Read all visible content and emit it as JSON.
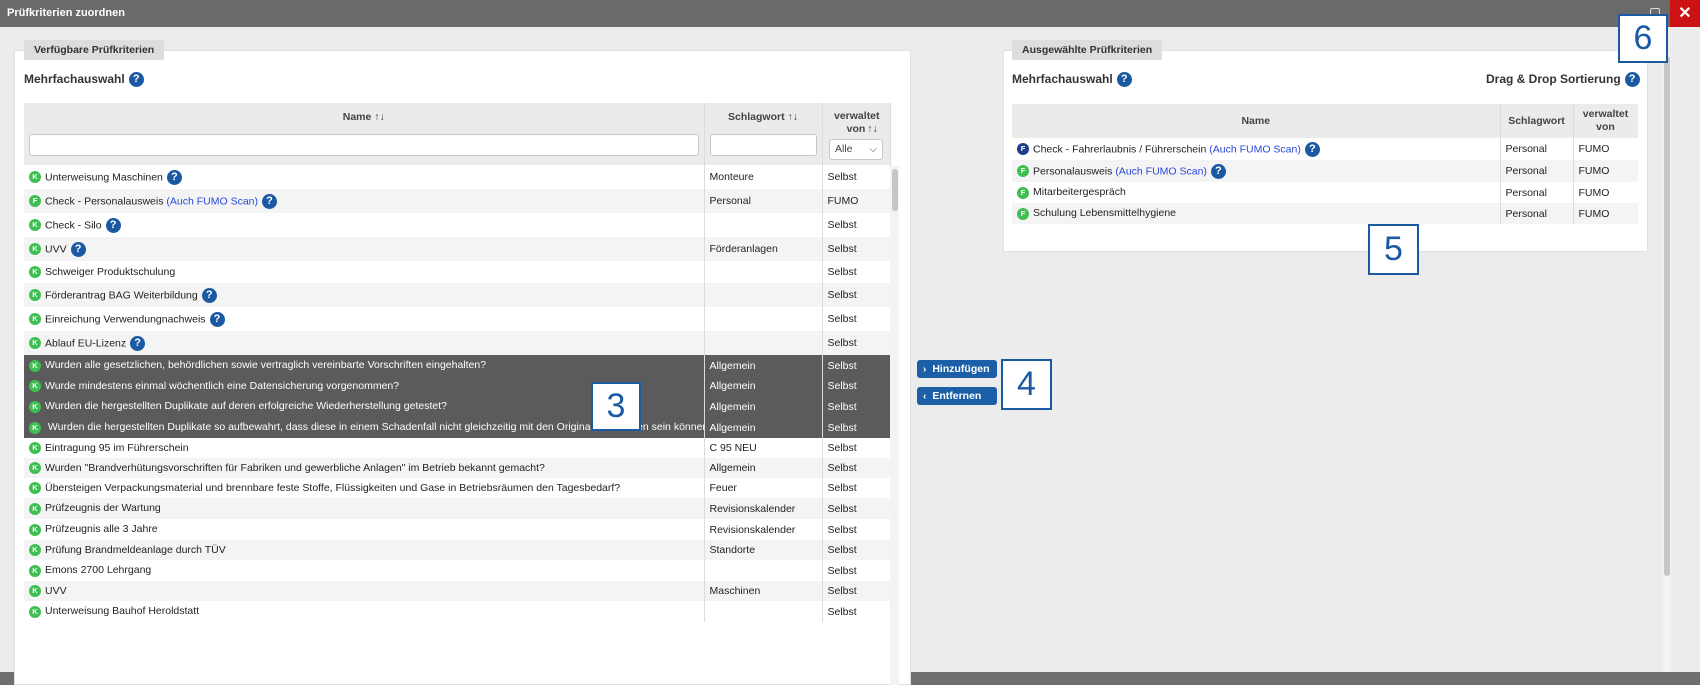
{
  "window": {
    "title": "Prüfkriterien zuordnen",
    "close_symbol": "✕"
  },
  "left": {
    "legend": "Verfügbare Prüfkriterien",
    "multi_label": "Mehrfachauswahl",
    "columns": {
      "name": "Name",
      "keyword": "Schlagwort",
      "managed": "verwaltet von",
      "sort_symbol": "↑↓"
    },
    "filter_select": "Alle",
    "rows": [
      {
        "badge": "K",
        "name": "Unterweisung Maschinen",
        "help": true,
        "keyword": "Monteure",
        "managed": "Selbst"
      },
      {
        "badge": "F",
        "name": "Check - Personalausweis",
        "fumo": "(Auch FUMO Scan)",
        "help": true,
        "keyword": "Personal",
        "managed": "FUMO"
      },
      {
        "badge": "K",
        "name": "Check - Silo",
        "help": true,
        "keyword": "",
        "managed": "Selbst"
      },
      {
        "badge": "K",
        "name": "UVV",
        "help": true,
        "keyword": "Förderanlagen",
        "managed": "Selbst"
      },
      {
        "badge": "K",
        "name": "Schweiger Produktschulung",
        "help": false,
        "keyword": "",
        "managed": "Selbst"
      },
      {
        "badge": "K",
        "name": "Förderantrag BAG Weiterbildung",
        "help": true,
        "keyword": "",
        "managed": "Selbst"
      },
      {
        "badge": "K",
        "name": "Einreichung Verwendungnachweis",
        "help": true,
        "keyword": "",
        "managed": "Selbst"
      },
      {
        "badge": "K",
        "name": "Ablauf EU-Lizenz",
        "help": true,
        "keyword": "",
        "managed": "Selbst"
      },
      {
        "badge": "K",
        "name": "Wurden alle gesetzlichen, behördlichen sowie vertraglich vereinbarte Vorschriften eingehalten?",
        "help": false,
        "keyword": "Allgemein",
        "managed": "Selbst",
        "selected": true
      },
      {
        "badge": "K",
        "name": "Wurde mindestens einmal wöchentlich eine Datensicherung vorgenommen?",
        "help": false,
        "keyword": "Allgemein",
        "managed": "Selbst",
        "selected": true
      },
      {
        "badge": "K",
        "name": "Wurden die hergestellten Duplikate auf deren erfolgreiche Wiederherstellung getestet?",
        "help": false,
        "keyword": "Allgemein",
        "managed": "Selbst",
        "selected": true
      },
      {
        "badge": "K",
        "name": " Wurden die hergestellten Duplikate so aufbewahrt, dass diese in einem Schadenfall nicht gleichzeitig mit den Originalen betroffen sein können?",
        "help": false,
        "keyword": "Allgemein",
        "managed": "Selbst",
        "selected": true
      },
      {
        "badge": "K",
        "name": "Eintragung 95 im Führerschein",
        "help": false,
        "keyword": "C 95 NEU",
        "managed": "Selbst"
      },
      {
        "badge": "K",
        "name": "Wurden \"Brandverhütungsvorschriften für Fabriken und gewerbliche Anlagen\" im Betrieb bekannt gemacht?",
        "help": false,
        "keyword": "Allgemein",
        "managed": "Selbst"
      },
      {
        "badge": "K",
        "name": "Übersteigen Verpackungsmaterial und brennbare feste Stoffe, Flüssigkeiten und Gase in Betriebsräumen den Tagesbedarf?",
        "help": false,
        "keyword": "Feuer",
        "managed": "Selbst"
      },
      {
        "badge": "K",
        "name": "Prüfzeugnis der Wartung",
        "help": false,
        "keyword": "Revisionskalender",
        "managed": "Selbst"
      },
      {
        "badge": "K",
        "name": "Prüfzeugnis alle 3 Jahre",
        "help": false,
        "keyword": "Revisionskalender",
        "managed": "Selbst"
      },
      {
        "badge": "K",
        "name": "Prüfung Brandmeldeanlage durch TÜV",
        "help": false,
        "keyword": "Standorte",
        "managed": "Selbst"
      },
      {
        "badge": "K",
        "name": "Emons 2700 Lehrgang",
        "help": false,
        "keyword": "",
        "managed": "Selbst"
      },
      {
        "badge": "K",
        "name": "UVV",
        "help": false,
        "keyword": "Maschinen",
        "managed": "Selbst"
      },
      {
        "badge": "K",
        "name": "Unterweisung Bauhof Heroldstatt",
        "help": false,
        "keyword": "",
        "managed": "Selbst"
      }
    ]
  },
  "actions": {
    "add": "Hinzufügen",
    "remove": "Entfernen"
  },
  "right": {
    "legend": "Ausgewählte Prüfkriterien",
    "multi_label": "Mehrfachauswahl",
    "dnd_label": "Drag & Drop Sortierung",
    "columns": {
      "name": "Name",
      "keyword": "Schlagwort",
      "managed": "verwaltet von"
    },
    "rows": [
      {
        "badge": "F",
        "dark": true,
        "name": "Check - Fahrerlaubnis / Führerschein",
        "fumo": "(Auch FUMO Scan)",
        "help": true,
        "keyword": "Personal",
        "managed": "FUMO"
      },
      {
        "badge": "F",
        "name": "Personalausweis",
        "fumo": "(Auch FUMO Scan)",
        "help": true,
        "keyword": "Personal",
        "managed": "FUMO"
      },
      {
        "badge": "F",
        "name": "Mitarbeitergespräch",
        "help": false,
        "keyword": "Personal",
        "managed": "FUMO"
      },
      {
        "badge": "F",
        "name": "Schulung Lebensmittelhygiene",
        "help": false,
        "keyword": "Personal",
        "managed": "FUMO"
      }
    ]
  },
  "callouts": [
    "3",
    "4",
    "5",
    "6"
  ],
  "help_symbol": "?"
}
